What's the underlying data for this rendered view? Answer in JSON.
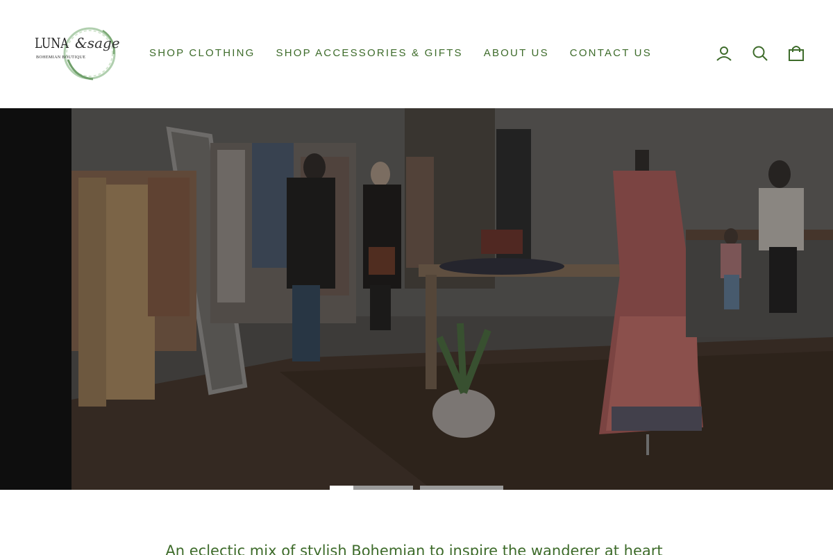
{
  "brand": {
    "name_primary": "LUNA",
    "name_secondary": "&sage",
    "tagline": "BOHEMIAN BOUTIQUE",
    "accent_color": "#3d6b2a"
  },
  "nav": {
    "items": [
      {
        "label": "SHOP CLOTHING"
      },
      {
        "label": "SHOP ACCESSORIES & GIFTS"
      },
      {
        "label": "ABOUT US"
      },
      {
        "label": "CONTACT US"
      }
    ]
  },
  "header_icons": [
    {
      "name": "user-icon",
      "label": "Log in"
    },
    {
      "name": "search-icon",
      "label": "Search"
    },
    {
      "name": "bag-icon",
      "label": "Cart"
    }
  ],
  "hero": {
    "slides_total": 3,
    "active_slide": 1
  },
  "intro": {
    "text": "An eclectic mix of stylish Bohemian to inspire the wanderer at heart"
  }
}
